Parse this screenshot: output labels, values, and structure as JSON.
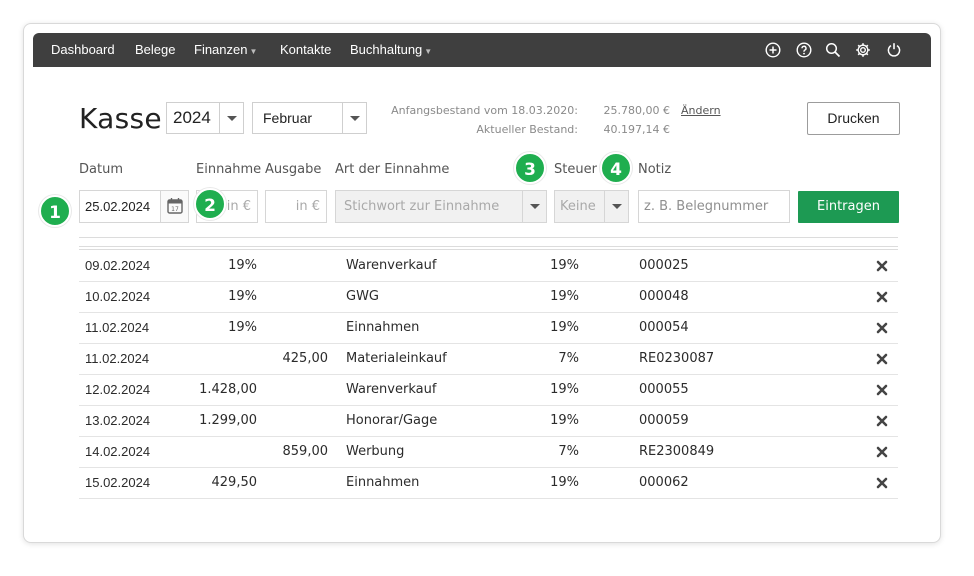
{
  "nav": {
    "items": [
      {
        "label": "Dashboard",
        "has_caret": false
      },
      {
        "label": "Belege",
        "has_caret": false
      },
      {
        "label": "Finanzen",
        "has_caret": true
      },
      {
        "label": "Kontakte",
        "has_caret": false
      },
      {
        "label": "Buchhaltung",
        "has_caret": true
      }
    ],
    "icons": [
      "plus-circle-icon",
      "help-icon",
      "search-icon",
      "gear-icon",
      "power-icon"
    ]
  },
  "header": {
    "title": "Kasse",
    "year": "2024",
    "month": "Februar",
    "opening_label": "Anfangsbestand vom 18.03.2020:",
    "opening_value": "25.780,00 €",
    "current_label": "Aktueller Bestand:",
    "current_value": "40.197,14 €",
    "change_link": "Ändern",
    "print_button": "Drucken"
  },
  "columns": {
    "date": "Datum",
    "income": "Einnahme",
    "expense": "Ausgabe",
    "type": "Art der Einnahme",
    "tax": "Steuer",
    "note": "Notiz"
  },
  "form": {
    "date_value": "25.02.2024",
    "income_placeholder": "in €",
    "expense_placeholder": "in €",
    "type_placeholder": "Stichwort zur Einnahme",
    "tax_value": "Keine",
    "note_placeholder": "z. B. Belegnummer",
    "submit_button": "Eintragen"
  },
  "badges": [
    "1",
    "2",
    "3",
    "4"
  ],
  "entries": [
    {
      "date": "09.02.2024",
      "income": "19%",
      "expense": "",
      "type": "Warenverkauf",
      "tax": "19%",
      "note": "000025"
    },
    {
      "date": "10.02.2024",
      "income": "19%",
      "expense": "",
      "type": "GWG",
      "tax": "19%",
      "note": "000048"
    },
    {
      "date": "11.02.2024",
      "income": "19%",
      "expense": "",
      "type": "Einnahmen",
      "tax": "19%",
      "note": "000054"
    },
    {
      "date": "11.02.2024",
      "income": "",
      "expense": "425,00",
      "type": "Materialeinkauf",
      "tax": "7%",
      "note": "RE0230087"
    },
    {
      "date": "12.02.2024",
      "income": "1.428,00",
      "expense": "",
      "type": "Warenverkauf",
      "tax": "19%",
      "note": "000055"
    },
    {
      "date": "13.02.2024",
      "income": "1.299,00",
      "expense": "",
      "type": "Honorar/Gage",
      "tax": "19%",
      "note": "000059"
    },
    {
      "date": "14.02.2024",
      "income": "",
      "expense": "859,00",
      "type": "Werbung",
      "tax": "7%",
      "note": "RE2300849"
    },
    {
      "date": "15.02.2024",
      "income": "429,50",
      "expense": "",
      "type": "Einnahmen",
      "tax": "19%",
      "note": "000062"
    }
  ],
  "colors": {
    "navbar": "#3f3f3f",
    "accent_green": "#1d9a53",
    "badge_green": "#1fae4f"
  }
}
